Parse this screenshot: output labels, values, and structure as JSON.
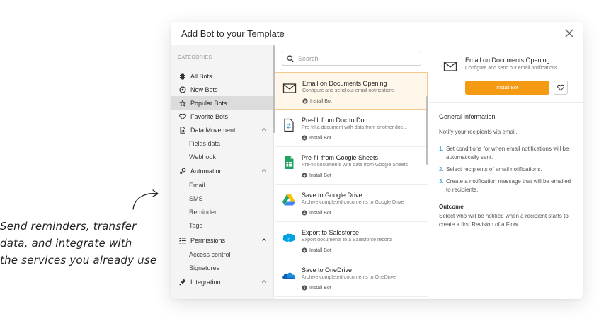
{
  "annotation": {
    "lines": [
      "Send reminders, transfer",
      "data, and integrate with",
      "the services you already use"
    ]
  },
  "modal": {
    "title": "Add Bot to your Template"
  },
  "sidebar": {
    "heading": "CATEGORIES",
    "items": [
      {
        "label": "All Bots",
        "icon": "bot-icon"
      },
      {
        "label": "New Bots",
        "icon": "new-icon"
      },
      {
        "label": "Popular Bots",
        "icon": "star-icon",
        "active": true
      },
      {
        "label": "Favorite Bots",
        "icon": "heart-icon"
      },
      {
        "label": "Data Movement",
        "icon": "data-movement-icon",
        "expanded": true
      },
      {
        "label": "Automation",
        "icon": "automation-icon",
        "expanded": true
      },
      {
        "label": "Permissions",
        "icon": "permissions-icon",
        "expanded": true
      },
      {
        "label": "Integration",
        "icon": "integration-icon",
        "expanded": true
      }
    ],
    "sub": {
      "data_movement": [
        "Fields data",
        "Webhook"
      ],
      "automation": [
        "Email",
        "SMS",
        "Reminder",
        "Tags"
      ],
      "permissions": [
        "Access control",
        "Signatures"
      ]
    }
  },
  "search": {
    "placeholder": "Search"
  },
  "bots": [
    {
      "title": "Email on Documents Opening",
      "desc": "Configure and send out email notifications",
      "install": "Install Bot",
      "icon": "envelope-icon",
      "selected": true
    },
    {
      "title": "Pre-fill from Doc to Doc",
      "desc": "Pre-fill a document with data from another doc...",
      "install": "Install Bot",
      "icon": "doc-to-doc-icon"
    },
    {
      "title": "Pre-fill from Google Sheets",
      "desc": "Pre-fill documents with data from Google Sheets",
      "install": "Install Bot",
      "icon": "google-sheets-icon"
    },
    {
      "title": "Save to Google Drive",
      "desc": "Archive completed documents to Google Drive",
      "install": "Install Bot",
      "icon": "google-drive-icon"
    },
    {
      "title": "Export to Salesforce",
      "desc": "Export documents to a Salesforce record",
      "install": "Install Bot",
      "icon": "salesforce-icon"
    },
    {
      "title": "Save to OneDrive",
      "desc": "Archive completed documents to OneDrive",
      "install": "Install Bot",
      "icon": "onedrive-icon"
    }
  ],
  "detail": {
    "title": "Email on Documents Opening",
    "desc": "Configure and send out email notifications",
    "install_label": "Install Bot",
    "general_title": "General Information",
    "general_text": "Notify your recipients via email.",
    "steps": [
      "Set conditions for when email notifications will be automatically sent.",
      "Select recipients of email notifications.",
      "Create a notification message that will be emailed to recipients."
    ],
    "step_numbers": [
      "1.",
      "2.",
      "3."
    ],
    "outcome_title": "Outcome",
    "outcome_text": "Select who will be notified when a recipient starts to create a first Revision of a Flow."
  },
  "colors": {
    "accent": "#f59a13",
    "link": "#2d8fd5",
    "selected_bg": "#fff7ea"
  }
}
